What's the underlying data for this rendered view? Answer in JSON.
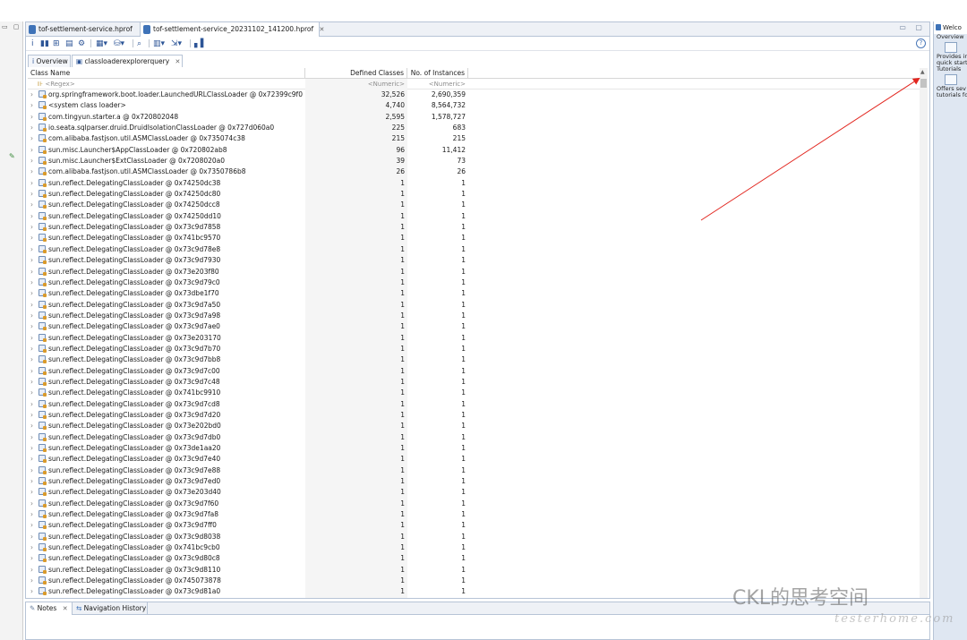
{
  "editor_tabs": [
    {
      "label": "tof-settlement-service.hprof",
      "active": false
    },
    {
      "label": "tof-settlement-service_20231102_141200.hprof",
      "active": true
    }
  ],
  "sub_tabs": [
    {
      "label": "Overview",
      "active": false
    },
    {
      "label": "classloaderexplorerquery",
      "active": true
    }
  ],
  "table": {
    "columns": [
      "Class Name",
      "Defined Classes",
      "No. of Instances"
    ],
    "filters": [
      "<Regex>",
      "<Numeric>",
      "<Numeric>"
    ],
    "rows": [
      {
        "name": "org.springframework.boot.loader.LaunchedURLClassLoader @ 0x72399c9f0",
        "defined": "32,526",
        "instances": "2,690,359"
      },
      {
        "name": "<system class loader>",
        "defined": "4,740",
        "instances": "8,564,732"
      },
      {
        "name": "com.tingyun.starter.a @ 0x720802048",
        "defined": "2,595",
        "instances": "1,578,727"
      },
      {
        "name": "io.seata.sqlparser.druid.DruidIsolationClassLoader @ 0x727d060a0",
        "defined": "225",
        "instances": "683"
      },
      {
        "name": "com.alibaba.fastjson.util.ASMClassLoader @ 0x735074c38",
        "defined": "215",
        "instances": "215"
      },
      {
        "name": "sun.misc.Launcher$AppClassLoader @ 0x720802ab8",
        "defined": "96",
        "instances": "11,412"
      },
      {
        "name": "sun.misc.Launcher$ExtClassLoader @ 0x7208020a0",
        "defined": "39",
        "instances": "73"
      },
      {
        "name": "com.alibaba.fastjson.util.ASMClassLoader @ 0x7350786b8",
        "defined": "26",
        "instances": "26"
      },
      {
        "name": "sun.reflect.DelegatingClassLoader @ 0x74250dc38",
        "defined": "1",
        "instances": "1"
      },
      {
        "name": "sun.reflect.DelegatingClassLoader @ 0x74250dc80",
        "defined": "1",
        "instances": "1"
      },
      {
        "name": "sun.reflect.DelegatingClassLoader @ 0x74250dcc8",
        "defined": "1",
        "instances": "1"
      },
      {
        "name": "sun.reflect.DelegatingClassLoader @ 0x74250dd10",
        "defined": "1",
        "instances": "1"
      },
      {
        "name": "sun.reflect.DelegatingClassLoader @ 0x73c9d7858",
        "defined": "1",
        "instances": "1"
      },
      {
        "name": "sun.reflect.DelegatingClassLoader @ 0x741bc9570",
        "defined": "1",
        "instances": "1"
      },
      {
        "name": "sun.reflect.DelegatingClassLoader @ 0x73c9d78e8",
        "defined": "1",
        "instances": "1"
      },
      {
        "name": "sun.reflect.DelegatingClassLoader @ 0x73c9d7930",
        "defined": "1",
        "instances": "1"
      },
      {
        "name": "sun.reflect.DelegatingClassLoader @ 0x73e203f80",
        "defined": "1",
        "instances": "1"
      },
      {
        "name": "sun.reflect.DelegatingClassLoader @ 0x73c9d79c0",
        "defined": "1",
        "instances": "1"
      },
      {
        "name": "sun.reflect.DelegatingClassLoader @ 0x73dbe1f70",
        "defined": "1",
        "instances": "1"
      },
      {
        "name": "sun.reflect.DelegatingClassLoader @ 0x73c9d7a50",
        "defined": "1",
        "instances": "1"
      },
      {
        "name": "sun.reflect.DelegatingClassLoader @ 0x73c9d7a98",
        "defined": "1",
        "instances": "1"
      },
      {
        "name": "sun.reflect.DelegatingClassLoader @ 0x73c9d7ae0",
        "defined": "1",
        "instances": "1"
      },
      {
        "name": "sun.reflect.DelegatingClassLoader @ 0x73e203170",
        "defined": "1",
        "instances": "1"
      },
      {
        "name": "sun.reflect.DelegatingClassLoader @ 0x73c9d7b70",
        "defined": "1",
        "instances": "1"
      },
      {
        "name": "sun.reflect.DelegatingClassLoader @ 0x73c9d7bb8",
        "defined": "1",
        "instances": "1"
      },
      {
        "name": "sun.reflect.DelegatingClassLoader @ 0x73c9d7c00",
        "defined": "1",
        "instances": "1"
      },
      {
        "name": "sun.reflect.DelegatingClassLoader @ 0x73c9d7c48",
        "defined": "1",
        "instances": "1"
      },
      {
        "name": "sun.reflect.DelegatingClassLoader @ 0x741bc9910",
        "defined": "1",
        "instances": "1"
      },
      {
        "name": "sun.reflect.DelegatingClassLoader @ 0x73c9d7cd8",
        "defined": "1",
        "instances": "1"
      },
      {
        "name": "sun.reflect.DelegatingClassLoader @ 0x73c9d7d20",
        "defined": "1",
        "instances": "1"
      },
      {
        "name": "sun.reflect.DelegatingClassLoader @ 0x73e202bd0",
        "defined": "1",
        "instances": "1"
      },
      {
        "name": "sun.reflect.DelegatingClassLoader @ 0x73c9d7db0",
        "defined": "1",
        "instances": "1"
      },
      {
        "name": "sun.reflect.DelegatingClassLoader @ 0x73de1aa20",
        "defined": "1",
        "instances": "1"
      },
      {
        "name": "sun.reflect.DelegatingClassLoader @ 0x73c9d7e40",
        "defined": "1",
        "instances": "1"
      },
      {
        "name": "sun.reflect.DelegatingClassLoader @ 0x73c9d7e88",
        "defined": "1",
        "instances": "1"
      },
      {
        "name": "sun.reflect.DelegatingClassLoader @ 0x73c9d7ed0",
        "defined": "1",
        "instances": "1"
      },
      {
        "name": "sun.reflect.DelegatingClassLoader @ 0x73e203d40",
        "defined": "1",
        "instances": "1"
      },
      {
        "name": "sun.reflect.DelegatingClassLoader @ 0x73c9d7f60",
        "defined": "1",
        "instances": "1"
      },
      {
        "name": "sun.reflect.DelegatingClassLoader @ 0x73c9d7fa8",
        "defined": "1",
        "instances": "1"
      },
      {
        "name": "sun.reflect.DelegatingClassLoader @ 0x73c9d7ff0",
        "defined": "1",
        "instances": "1"
      },
      {
        "name": "sun.reflect.DelegatingClassLoader @ 0x73c9d8038",
        "defined": "1",
        "instances": "1"
      },
      {
        "name": "sun.reflect.DelegatingClassLoader @ 0x741bc9cb0",
        "defined": "1",
        "instances": "1"
      },
      {
        "name": "sun.reflect.DelegatingClassLoader @ 0x73c9d80c8",
        "defined": "1",
        "instances": "1"
      },
      {
        "name": "sun.reflect.DelegatingClassLoader @ 0x73c9d8110",
        "defined": "1",
        "instances": "1"
      },
      {
        "name": "sun.reflect.DelegatingClassLoader @ 0x745073878",
        "defined": "1",
        "instances": "1"
      },
      {
        "name": "sun.reflect.DelegatingClassLoader @ 0x73c9d81a0",
        "defined": "1",
        "instances": "1"
      }
    ]
  },
  "notes_tabs": [
    {
      "label": "Notes",
      "active": true
    },
    {
      "label": "Navigation History",
      "active": false
    }
  ],
  "welcome": {
    "tab_label": "Welco",
    "lines_top": [
      "Overview",
      "Provides ir",
      "quick start"
    ],
    "tutorials": "Tutorials",
    "lines_bottom": [
      "Offers sev",
      "tutorials fo"
    ]
  },
  "watermark": {
    "main": "CKL的思考空间",
    "sub": "testerhome.com"
  },
  "colors": {
    "accent": "#3f73b8",
    "arrow": "#e2261f"
  }
}
